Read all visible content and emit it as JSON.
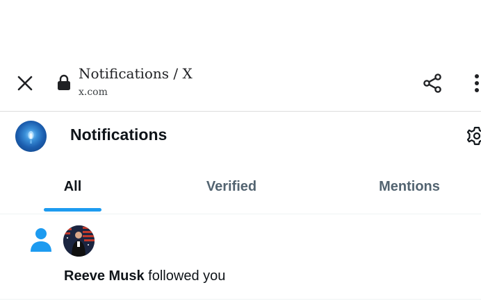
{
  "browser": {
    "page_title": "Notifications / X",
    "url": "x.com",
    "icons": {
      "close": "close-icon",
      "lock": "lock-icon",
      "share": "share-icon",
      "more": "more-vertical-icon"
    }
  },
  "header": {
    "title": "Notifications",
    "icons": {
      "settings": "gear-icon"
    }
  },
  "tabs": [
    {
      "label": "All",
      "active": true
    },
    {
      "label": "Verified",
      "active": false
    },
    {
      "label": "Mentions",
      "active": false
    }
  ],
  "notifications": [
    {
      "icon": "person-icon",
      "user_name": "Reeve Musk",
      "action_text": " followed you"
    }
  ],
  "colors": {
    "accent": "#1d9bf0",
    "text_primary": "#0f1419",
    "text_secondary": "#536471",
    "divider": "#eff3f4"
  }
}
